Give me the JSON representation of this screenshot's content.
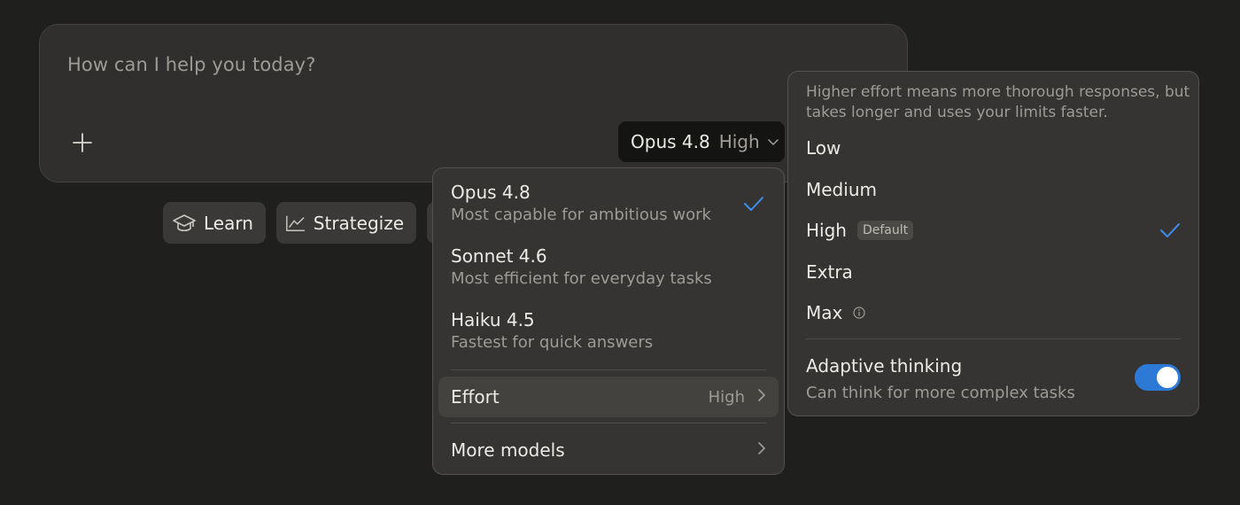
{
  "composer": {
    "placeholder": "How can I help you today?"
  },
  "model_selector": {
    "model": "Opus 4.8",
    "effort": "High"
  },
  "chips": [
    {
      "label": "Learn",
      "icon": "graduation-cap-icon"
    },
    {
      "label": "Strategize",
      "icon": "line-chart-icon"
    }
  ],
  "model_menu": {
    "items": [
      {
        "title": "Opus 4.8",
        "subtitle": "Most capable for ambitious work",
        "selected": true
      },
      {
        "title": "Sonnet 4.6",
        "subtitle": "Most efficient for everyday tasks",
        "selected": false
      },
      {
        "title": "Haiku 4.5",
        "subtitle": "Fastest for quick answers",
        "selected": false
      }
    ],
    "effort_label": "Effort",
    "effort_value": "High",
    "more_models_label": "More models"
  },
  "effort_panel": {
    "description": "Higher effort means more thorough responses, but takes longer and uses your limits faster.",
    "options": [
      {
        "label": "Low"
      },
      {
        "label": "Medium"
      },
      {
        "label": "High",
        "badge": "Default",
        "selected": true
      },
      {
        "label": "Extra"
      },
      {
        "label": "Max",
        "info": true
      }
    ],
    "adaptive_title": "Adaptive thinking",
    "adaptive_subtitle": "Can think for more complex tasks",
    "adaptive_enabled": true
  },
  "colors": {
    "background": "#1f1f1e",
    "surface": "#353432",
    "accent_check": "#3b8ff0",
    "toggle_on": "#2c7ad6"
  }
}
